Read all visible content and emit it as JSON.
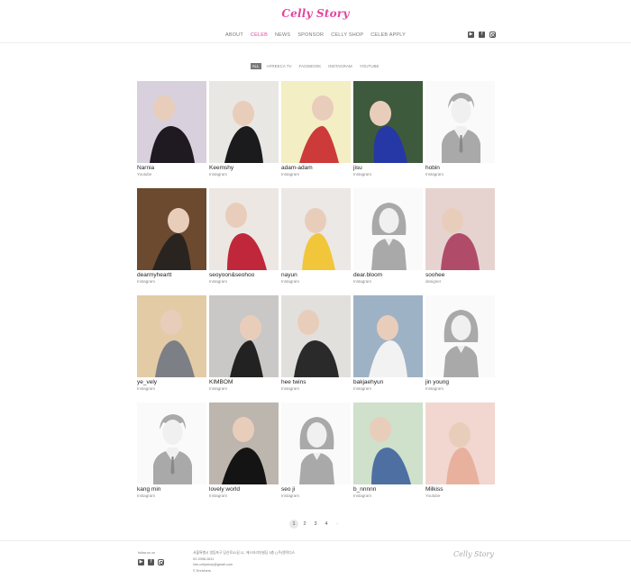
{
  "header": {
    "logo": "Celly Story",
    "nav": [
      "ABOUT",
      "CELEB",
      "NEWS",
      "SPONSOR",
      "CELLY SHOP",
      "CELEB APPLY"
    ],
    "active_nav": "CELEB",
    "social_icons": [
      "youtube-icon",
      "facebook-icon",
      "instagram-icon"
    ]
  },
  "filters": {
    "items": [
      "ALL",
      "AFREECA TV",
      "FACEBOOK",
      "INSTAGRAM",
      "YOUTUBE"
    ],
    "active": "ALL"
  },
  "celebs": [
    {
      "name": "Narnia",
      "source": "Youtube",
      "kind": "photo",
      "bg": "#d8d0dc",
      "fg": "#1f1a22"
    },
    {
      "name": "Keemshy",
      "source": "Instagram",
      "kind": "photo",
      "bg": "#e9e7e4",
      "fg": "#1b1b1d"
    },
    {
      "name": "adam-adam",
      "source": "Instagram",
      "kind": "photo",
      "bg": "#f3eec4",
      "fg": "#cd3a3a"
    },
    {
      "name": "jisu",
      "source": "Instagram",
      "kind": "photo",
      "bg": "#3e5a3c",
      "fg": "#2637a6"
    },
    {
      "name": "hobin",
      "source": "Instagram",
      "kind": "placeholder-male"
    },
    {
      "name": "dearmyheartt",
      "source": "Instagram",
      "kind": "photo",
      "bg": "#6b4a30",
      "fg": "#2a2420"
    },
    {
      "name": "seoyoon&seohoo",
      "source": "Instagram",
      "kind": "photo",
      "bg": "#ece7e3",
      "fg": "#c0273a"
    },
    {
      "name": "nayun",
      "source": "Instagram",
      "kind": "photo",
      "bg": "#ebe8e6",
      "fg": "#f2c63a"
    },
    {
      "name": "dear.bloom",
      "source": "Instagram",
      "kind": "placeholder-female"
    },
    {
      "name": "soohee",
      "source": "designer",
      "kind": "photo",
      "bg": "#e6d3d0",
      "fg": "#b04c6a"
    },
    {
      "name": "ye_vely",
      "source": "Instagram",
      "kind": "photo",
      "bg": "#e3cba6",
      "fg": "#7c7f86"
    },
    {
      "name": "KIMBOM",
      "source": "Instagram",
      "kind": "photo",
      "bg": "#c9c8c6",
      "fg": "#222"
    },
    {
      "name": "hee twins",
      "source": "Instagram",
      "kind": "photo",
      "bg": "#e2e0dc",
      "fg": "#2a2a2a"
    },
    {
      "name": "bakjaehyun",
      "source": "Instagram",
      "kind": "photo",
      "bg": "#9eb2c6",
      "fg": "#f2f2f2"
    },
    {
      "name": "jin young",
      "source": "Instagram",
      "kind": "placeholder-female"
    },
    {
      "name": "kang min",
      "source": "Instagram",
      "kind": "placeholder-male"
    },
    {
      "name": "lovely world",
      "source": "Instagram",
      "kind": "photo",
      "bg": "#bdb6ae",
      "fg": "#141414"
    },
    {
      "name": "seo ji",
      "source": "Instagram",
      "kind": "placeholder-female"
    },
    {
      "name": "b_nnnnn",
      "source": "Instagram",
      "kind": "photo",
      "bg": "#cfe0cb",
      "fg": "#4e6fa1"
    },
    {
      "name": "Milkiss",
      "source": "Youtube",
      "kind": "photo",
      "bg": "#f1d7cf",
      "fg": "#e8b19e"
    }
  ],
  "pagination": {
    "pages": [
      "1",
      "2",
      "3",
      "4"
    ],
    "active": "1",
    "next": "›"
  },
  "footer": {
    "follow_label": "follow us on",
    "address": "서울특별시 영등포구 당산로41길 11, 에스티리더빌딩 3층  |  (주)엔릭디스",
    "phone": "02-3398-2811",
    "email": "info.cellystory@gmail.com",
    "copyright": "© Enrichers",
    "logo": "Celly Story"
  },
  "colors": {
    "accent": "#e0479e",
    "placeholder_figure": "#a9a9a9"
  }
}
